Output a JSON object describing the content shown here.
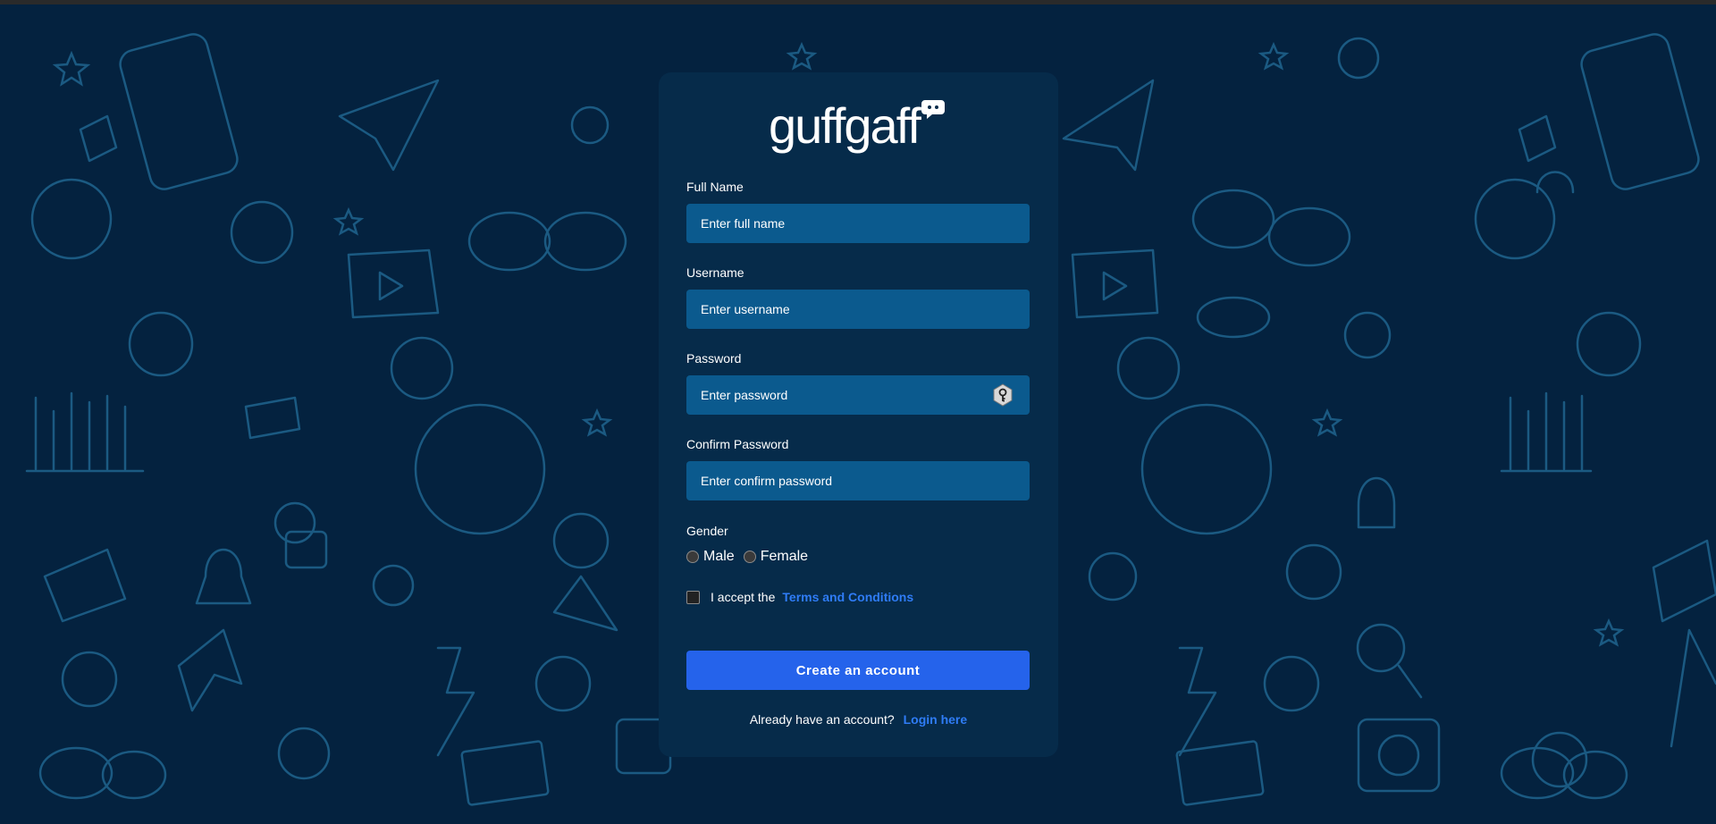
{
  "brand": {
    "logo_text": "guffgaff"
  },
  "form": {
    "full_name": {
      "label": "Full Name",
      "placeholder": "Enter full name"
    },
    "username": {
      "label": "Username",
      "placeholder": "Enter username"
    },
    "password": {
      "label": "Password",
      "placeholder": "Enter password"
    },
    "confirm_password": {
      "label": "Confirm Password",
      "placeholder": "Enter confirm password"
    },
    "gender": {
      "label": "Gender",
      "options": [
        "Male",
        "Female"
      ]
    },
    "terms": {
      "text": "I accept the",
      "link": "Terms and Conditions"
    },
    "submit_label": "Create an account",
    "login": {
      "text": "Already have an account?",
      "link": "Login here"
    }
  },
  "colors": {
    "background": "#04223f",
    "card": "#062b4a",
    "input": "#0b5a8e",
    "accent": "#2563eb",
    "link": "#2f7cf6",
    "doodle": "#1e5f86"
  }
}
